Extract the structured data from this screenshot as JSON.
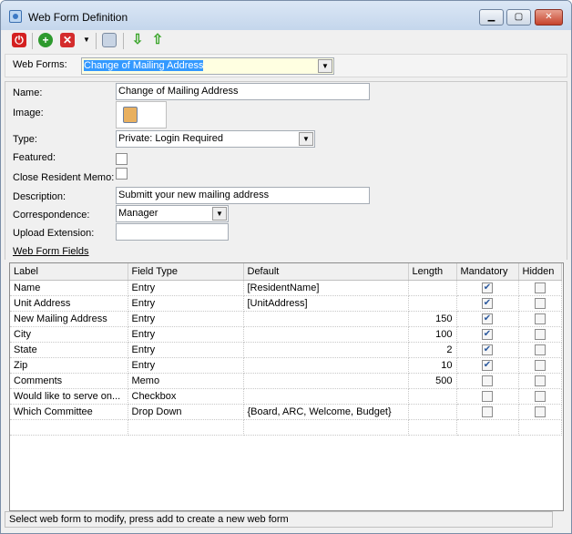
{
  "window": {
    "title": "Web Form Definition",
    "minimize": "▁",
    "maximize": "▢",
    "close": "✕"
  },
  "toolbar": {
    "icons": [
      "power-icon",
      "add-icon",
      "delete-icon",
      "dropdown-arrow-icon",
      "copy-icon",
      "move-down-icon",
      "move-up-icon"
    ]
  },
  "web_forms": {
    "label": "Web Forms:",
    "value": "Change of Mailing Address"
  },
  "form": {
    "name_label": "Name:",
    "name_value": "Change of Mailing Address",
    "image_label": "Image:",
    "type_label": "Type:",
    "type_value": "Private: Login Required",
    "featured_label": "Featured:",
    "featured_checked": false,
    "close_memo_label": "Close Resident Memo:",
    "close_memo_checked": false,
    "description_label": "Description:",
    "description_value": "Submitt your new mailing address",
    "correspondence_label": "Correspondence:",
    "correspondence_value": "Manager",
    "upload_label": "Upload Extension:",
    "upload_value": "",
    "fields_link": "Web Form Fields"
  },
  "grid": {
    "columns": [
      "Label",
      "Field Type",
      "Default",
      "Length",
      "Mandatory",
      "Hidden"
    ],
    "rows": [
      {
        "label": "Name",
        "type": "Entry",
        "default": "[ResidentName]",
        "length": "",
        "mandatory": true,
        "hidden": false
      },
      {
        "label": "Unit Address",
        "type": "Entry",
        "default": "[UnitAddress]",
        "length": "",
        "mandatory": true,
        "hidden": false
      },
      {
        "label": "New Mailing Address",
        "type": "Entry",
        "default": "",
        "length": "150",
        "mandatory": true,
        "hidden": false
      },
      {
        "label": "City",
        "type": "Entry",
        "default": "",
        "length": "100",
        "mandatory": true,
        "hidden": false
      },
      {
        "label": "State",
        "type": "Entry",
        "default": "",
        "length": "2",
        "mandatory": true,
        "hidden": false
      },
      {
        "label": "Zip",
        "type": "Entry",
        "default": "",
        "length": "10",
        "mandatory": true,
        "hidden": false
      },
      {
        "label": "Comments",
        "type": "Memo",
        "default": "",
        "length": "500",
        "mandatory": false,
        "hidden": false
      },
      {
        "label": "Would like to serve on...",
        "type": "Checkbox",
        "default": "",
        "length": "",
        "mandatory": false,
        "hidden": false
      },
      {
        "label": "Which Committee",
        "type": "Drop Down",
        "default": "{Board, ARC, Welcome, Budget}",
        "length": "",
        "mandatory": false,
        "hidden": false
      }
    ]
  },
  "status": "Select web form to modify, press add to create a new web form"
}
